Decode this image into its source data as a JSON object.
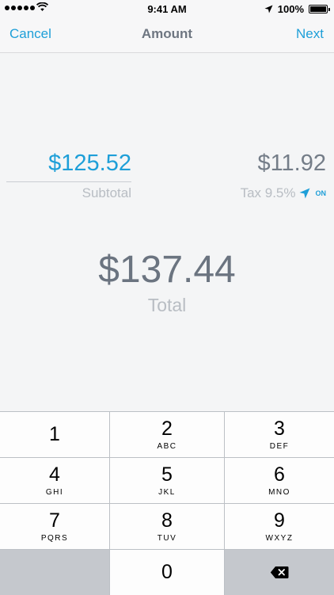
{
  "status_bar": {
    "time": "9:41 AM",
    "battery": "100%",
    "signal_dots": 5,
    "icons": [
      "signal-dots-icon",
      "wifi-icon",
      "location-arrow-icon",
      "battery-icon"
    ]
  },
  "nav": {
    "cancel_label": "Cancel",
    "title": "Amount",
    "next_label": "Next"
  },
  "amounts": {
    "subtotal_value": "$125.52",
    "subtotal_label": "Subtotal",
    "tax_value": "$11.92",
    "tax_label": "Tax 9.5%",
    "tax_toggle": "ON",
    "total_value": "$137.44",
    "total_label": "Total"
  },
  "keypad": {
    "keys": [
      {
        "digit": "1",
        "letters": ""
      },
      {
        "digit": "2",
        "letters": "ABC"
      },
      {
        "digit": "3",
        "letters": "DEF"
      },
      {
        "digit": "4",
        "letters": "GHI"
      },
      {
        "digit": "5",
        "letters": "JKL"
      },
      {
        "digit": "6",
        "letters": "MNO"
      },
      {
        "digit": "7",
        "letters": "PQRS"
      },
      {
        "digit": "8",
        "letters": "TUV"
      },
      {
        "digit": "9",
        "letters": "WXYZ"
      },
      {
        "digit": "0",
        "letters": ""
      }
    ]
  },
  "colors": {
    "accent": "#1e9fd8",
    "value_gray": "#747d88",
    "label_gray": "#b8bdc3"
  }
}
